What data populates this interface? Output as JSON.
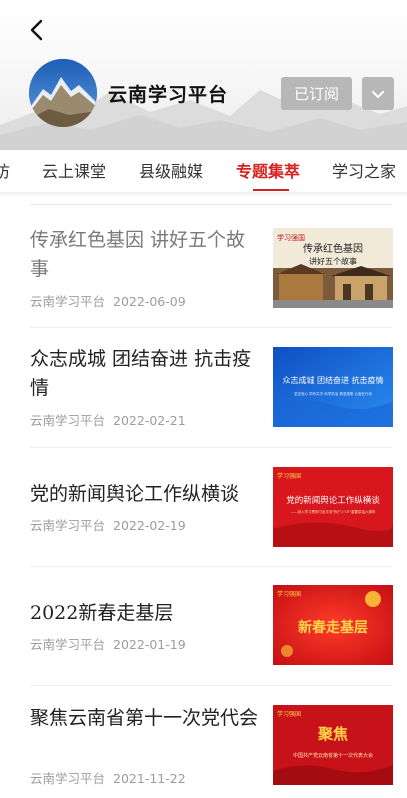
{
  "header": {
    "platform_name": "云南学习平台",
    "subscribe_label": "已订阅"
  },
  "tabs": [
    {
      "label": "云上课堂"
    },
    {
      "label": "县级融媒"
    },
    {
      "label": "专题集萃"
    },
    {
      "label": "学习之家"
    }
  ],
  "tabs_partial_left": "访",
  "active_tab": "专题集萃",
  "articles": [
    {
      "title": "传承红色基因 讲好五个故事",
      "source": "云南学习平台",
      "date": "2022-06-09",
      "read": true,
      "thumb_text": [
        "传承红色基因",
        "讲好五个故事"
      ]
    },
    {
      "title": "众志成城 团结奋进 抗击疫情",
      "source": "云南学习平台",
      "date": "2022-02-21",
      "read": false,
      "thumb_text": [
        "众志成城 团结奋进 抗击疫情",
        "坚定信心 同舟共济 科学防治 精准施策 云南在行动"
      ]
    },
    {
      "title": "党的新闻舆论工作纵横谈",
      "source": "云南学习平台",
      "date": "2022-02-19",
      "read": false,
      "thumb_text": [
        "党的新闻舆论工作纵横谈",
        "——深入学习贯彻习近平总书记“2·19”重要讲话六周年"
      ]
    },
    {
      "title": "2022新春走基层",
      "source": "云南学习平台",
      "date": "2022-01-19",
      "read": false,
      "thumb_text": [
        "新春走基层"
      ]
    },
    {
      "title": "聚焦云南省第十一次党代会",
      "source": "云南学习平台",
      "date": "2021-11-22",
      "read": false,
      "thumb_text": [
        "聚焦",
        "中国共产党云南省第十一次代表大会"
      ]
    }
  ],
  "thumb_brand": "学习强国",
  "thumb_brand_sub": "云南学习平台",
  "colors": {
    "accent": "#d62222",
    "subscribed_bg": "#b7b7b7",
    "meta": "#9d9d9d"
  }
}
